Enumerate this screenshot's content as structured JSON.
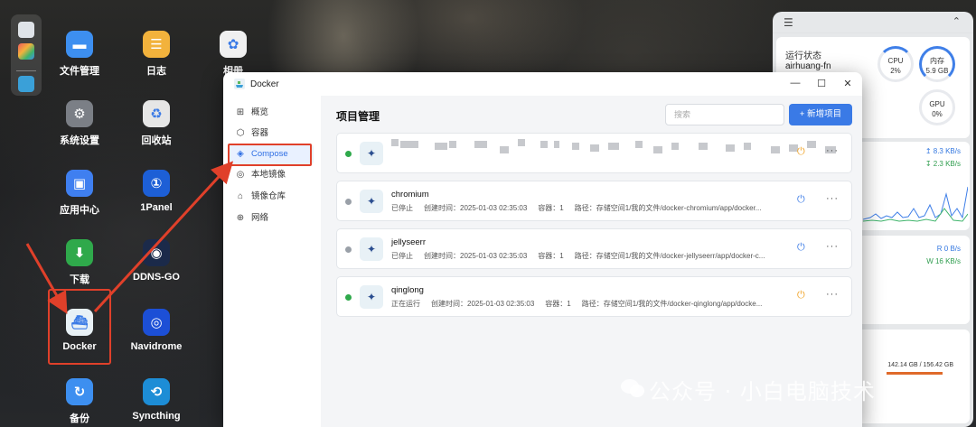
{
  "desktop": {
    "apps": [
      {
        "label": "文件管理",
        "icon": "folder-icon",
        "color": "#3d8ff0"
      },
      {
        "label": "日志",
        "icon": "log-icon",
        "color": "#f2b23c"
      },
      {
        "label": "相册",
        "icon": "photos-icon",
        "color": "#f0f0f0"
      },
      {
        "label": "系统设置",
        "icon": "gear-icon",
        "color": "#7b7f86"
      },
      {
        "label": "回收站",
        "icon": "recycle-icon",
        "color": "#e6e6e6"
      },
      {
        "label": "应用中心",
        "icon": "store-icon",
        "color": "#3f7ff0"
      },
      {
        "label": "1Panel",
        "icon": "1panel-icon",
        "color": "#1d5fd6"
      },
      {
        "label": "下载",
        "icon": "download-icon",
        "color": "#2fa94b"
      },
      {
        "label": "DDNS-GO",
        "icon": "ddns-icon",
        "color": "#1b2a4a"
      },
      {
        "label": "Docker",
        "icon": "docker-icon",
        "color": "#e8f1f6"
      },
      {
        "label": "Navidrome",
        "icon": "navidrome-icon",
        "color": "#1c4fd6"
      },
      {
        "label": "备份",
        "icon": "backup-icon",
        "color": "#3d8ff0"
      },
      {
        "label": "Syncthing",
        "icon": "syncthing-icon",
        "color": "#1d8dd6"
      }
    ]
  },
  "widget": {
    "status_title": "运行状态",
    "hostname": "airhuang-fn",
    "cpu_label": "CPU",
    "cpu_value": "2%",
    "mem_label": "内存",
    "mem_value": "5.9 GB",
    "gpu_label": "GPU",
    "gpu_value": "0%",
    "net_up": "↥ 8.3 KB/s",
    "net_down": "↧ 2.3 KB/s",
    "disk_read": "R    0 B/s",
    "disk_write": "W  16 KB/s",
    "storage": "142.14 GB / 156.42 GB"
  },
  "window": {
    "title": "Docker",
    "minimize": "—",
    "maximize": "☐",
    "close": "✕"
  },
  "sidebar": {
    "items": [
      {
        "label": "概览",
        "icon": "overview-icon"
      },
      {
        "label": "容器",
        "icon": "container-icon"
      },
      {
        "label": "Compose",
        "icon": "compose-icon"
      },
      {
        "label": "本地镜像",
        "icon": "image-icon"
      },
      {
        "label": "镜像仓库",
        "icon": "registry-icon"
      },
      {
        "label": "网络",
        "icon": "network-icon"
      }
    ]
  },
  "main": {
    "title": "项目管理",
    "search_placeholder": "搜索",
    "add_button": "+ 新增项目",
    "projects": [
      {
        "name": "",
        "status": "",
        "created": "",
        "containers": "",
        "path": "",
        "status_color": "#2fa94b",
        "power_color": "#f0a020"
      },
      {
        "name": "chromium",
        "status": "已停止",
        "created": "创建时间：2025-01-03 02:35:03",
        "containers": "容器：1",
        "path": "路径：存储空间1/我的文件/docker-chromium/app/docker...",
        "status_color": "#9aa0a8",
        "power_color": "#3a7ae6"
      },
      {
        "name": "jellyseerr",
        "status": "已停止",
        "created": "创建时间：2025-01-03 02:35:03",
        "containers": "容器：1",
        "path": "路径：存储空间1/我的文件/docker-jellyseerr/app/docker-c...",
        "status_color": "#9aa0a8",
        "power_color": "#3a7ae6"
      },
      {
        "name": "qinglong",
        "status": "正在运行",
        "created": "创建时间：2025-01-03 02:35:03",
        "containers": "容器：1",
        "path": "路径：存储空间1/我的文件/docker-qinglong/app/docke...",
        "status_color": "#2fa94b",
        "power_color": "#f0a020"
      }
    ]
  },
  "watermark": "公众号 · 小白电脑技术"
}
